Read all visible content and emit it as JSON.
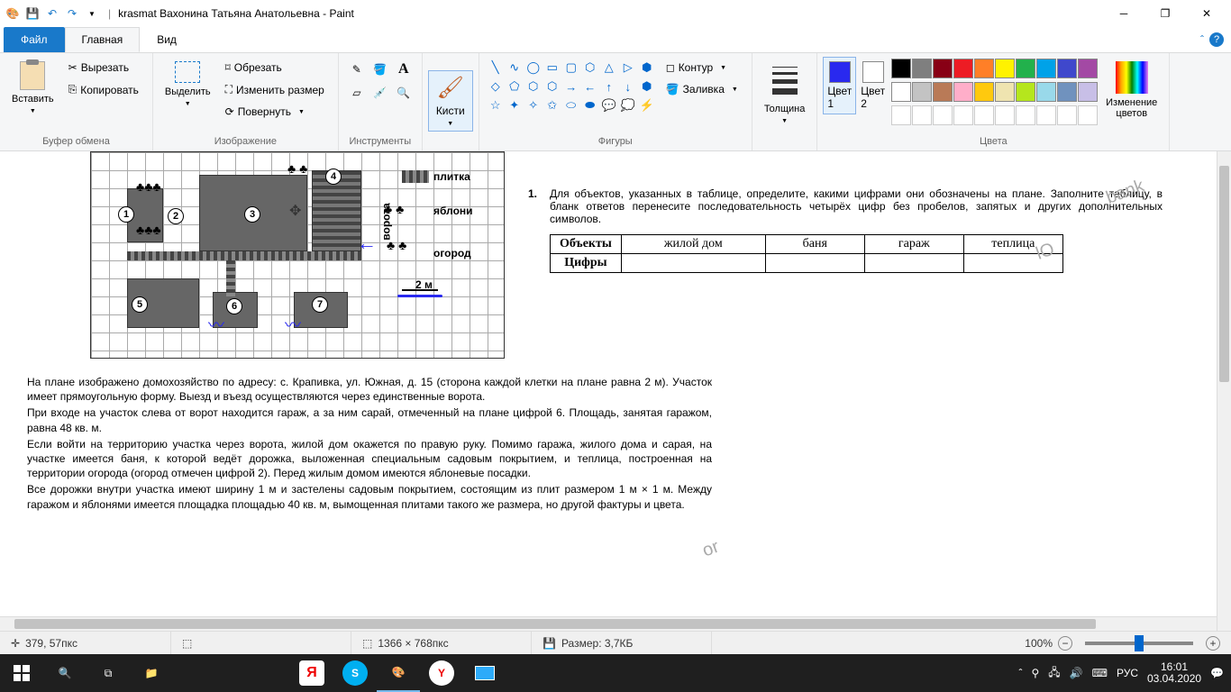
{
  "title": {
    "sep": "|",
    "doc": "krasmat Вахонина Татьяна Анатольевна - Paint"
  },
  "tabs": {
    "file": "Файл",
    "home": "Главная",
    "view": "Вид"
  },
  "ribbon": {
    "clipboard": {
      "paste": "Вставить",
      "cut": "Вырезать",
      "copy": "Копировать",
      "label": "Буфер обмена"
    },
    "image": {
      "select": "Выделить",
      "crop": "Обрезать",
      "resize": "Изменить размер",
      "rotate": "Повернуть",
      "label": "Изображение"
    },
    "tools": {
      "label": "Инструменты"
    },
    "brushes": {
      "btn": "Кисти"
    },
    "shapes": {
      "contour": "Контур",
      "fill": "Заливка",
      "label": "Фигуры"
    },
    "thickness": {
      "label": "Толщина"
    },
    "color1": {
      "label": "Цвет\n1",
      "v": "#2929ef"
    },
    "color2": {
      "label": "Цвет\n2",
      "v": "#ffffff"
    },
    "palette_top": [
      "#000000",
      "#7f7f7f",
      "#880015",
      "#ed1c24",
      "#ff7f27",
      "#fff200",
      "#22b14c",
      "#00a2e8",
      "#3f48cc",
      "#a349a4"
    ],
    "palette_bot": [
      "#ffffff",
      "#c3c3c3",
      "#b97a57",
      "#ffaec9",
      "#ffc90e",
      "#efe4b0",
      "#b5e61d",
      "#99d9ea",
      "#7092be",
      "#c8bfe7"
    ],
    "palette_empty": [
      "",
      "",
      "",
      "",
      "",
      "",
      "",
      "",
      "",
      ""
    ],
    "edit_colors": "Изменение\nцветов",
    "colors_label": "Цвета"
  },
  "doc": {
    "legend": {
      "plitka": "плитка",
      "yabloni": "яблони",
      "ogorod": "огород",
      "scale": "2 м",
      "vorota": "ворота"
    },
    "nums": [
      "1",
      "2",
      "3",
      "4",
      "5",
      "6",
      "7"
    ],
    "para1": "На плане изображено домохозяйство по адресу: с. Крапивка, ул. Южная, д. 15 (сторона каждой клетки на плане равна 2 м). Участок имеет прямоугольную форму. Выезд и въезд осуществляются через единственные ворота.",
    "para2": "При входе на участок слева от ворот находится гараж, а за ним сарай, отмеченный на плане цифрой 6. Площадь, занятая гаражом, равна 48 кв. м.",
    "para3": "Если войти на территорию участка через ворота, жилой дом окажется по правую руку. Помимо гаража, жилого дома и сарая, на участке имеется баня, к которой ведёт дорожка, выложенная специальным садовым покрытием, и теплица, построенная на территории огорода (огород отмечен цифрой 2). Перед жилым домом имеются яблоневые посадки.",
    "para4": "Все дорожки внутри участка имеют ширину 1 м и застелены садовым покрытием, состоящим из плит размером 1 м × 1 м. Между гаражом и яблонями имеется площадка площадью 40 кв. м, вымощенная плитами такого же размера, но другой фактуры и цвета.",
    "task_num": "1.",
    "task_text": "Для объектов, указанных в таблице, определите, какими цифрами они обозначены на плане. Заполните таблицу, в бланк ответов перенесите последовательность четырёх цифр без пробелов, запятых и других дополнительных символов.",
    "table": {
      "r1": "Объекты",
      "r2": "Цифры",
      "c1": "жилой дом",
      "c2": "баня",
      "c3": "гараж",
      "c4": "теплица"
    }
  },
  "status": {
    "coords": "379, 57пкс",
    "dims": "1366 × 768пкс",
    "size": "Размер: 3,7КБ",
    "zoom": "100%"
  },
  "tray": {
    "lang": "РУС",
    "time": "16:01",
    "date": "03.04.2020"
  }
}
